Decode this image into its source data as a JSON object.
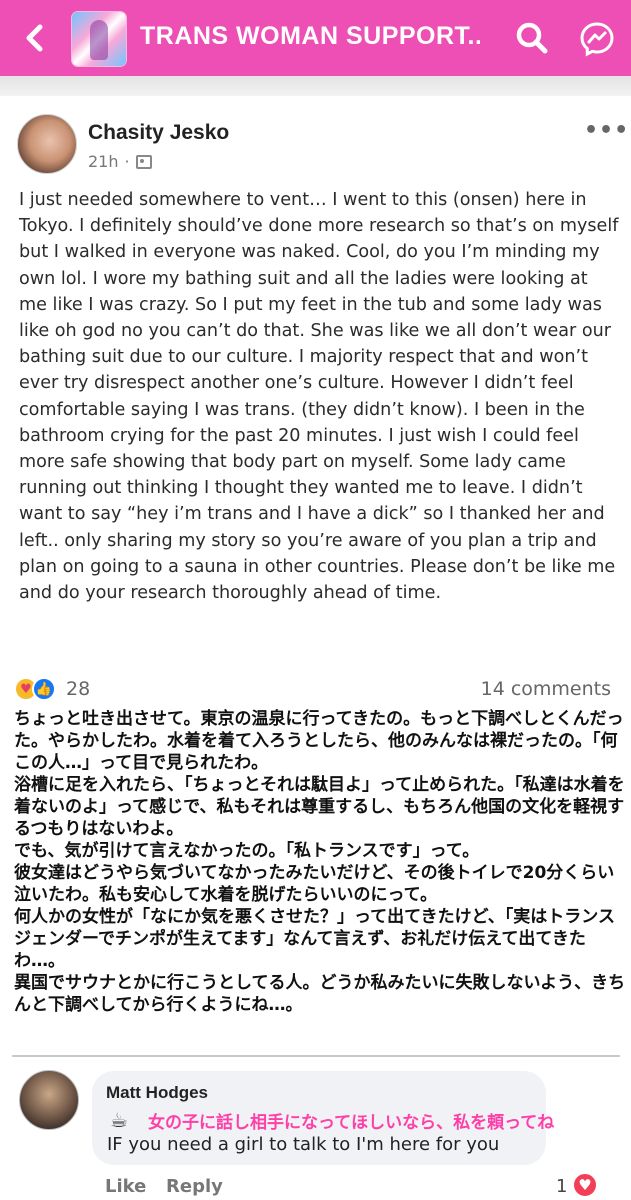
{
  "header": {
    "back_icon": "chevron-left-icon",
    "group_title": "TRANS WOMAN SUPPORT...",
    "search_icon": "search-icon",
    "messenger_icon": "messenger-icon",
    "background_color": "#ee4fb5"
  },
  "post": {
    "author": "Chasity Jesko",
    "time": "21h",
    "separator": "·",
    "audience_icon": "group-icon",
    "more_label": "•••",
    "text": "I just needed somewhere to vent… I went to this (onsen) here in Tokyo. I definitely should’ve done more research so that’s on myself but I walked in everyone was naked. Cool, do you I’m minding my own lol. I wore my bathing suit and all the ladies were looking at me like I was crazy. So I put my feet in the tub and some lady was like oh god no you can’t do that. She was like we all don’t wear our bathing suit due to our culture. I majority respect that and won’t ever try disrespect another one’s culture. However I didn’t feel comfortable saying I was trans. (they didn’t know). I been in the bathroom crying for the past 20 minutes. I just wish I could feel more safe showing that body part on myself. Some lady came running out thinking I thought they wanted me to leave. I didn’t want to say “hey i’m trans and I have a dick” so I thanked her and left.. only sharing my story so you’re aware of you plan a trip and plan on going to a sauna in other countries. Please don’t be like me and do your research thoroughly ahead of time.",
    "reaction_count": "28",
    "comments_count": "14 comments"
  },
  "translation": {
    "text": "ちょっと吐き出させて。東京の温泉に行ってきたの。もっと下調べしとくんだった。やらかしたわ。水着を着て入ろうとしたら、他のみんなは裸だったの。「何この人…」って目で見られたわ。\n浴槽に足を入れたら、「ちょっとそれは駄目よ」って止められた。「私達は水着を着ないのよ」って感じで、私もそれは尊重するし、もちろん他国の文化を軽視するつもりはないわよ。\nでも、気が引けて言えなかったの。「私トランスです」って。\n彼女達はどうやら気づいてなかったみたいだけど、その後トイレで20分くらい泣いたわ。私も安心して水着を脱げたらいいのにって。\n何人かの女性が「なにか気を悪くさせた？」って出てきたけど、「実はトランスジェンダーでチンポが生えてます」なんて言えず、お礼だけ伝えて出てきたわ…。\n異国でサウナとかに行こうとしてる人。どうか私みたいに失敗しないよう、きちんと下調べしてから行くようにね…。"
  },
  "comment": {
    "author": "Matt Hodges",
    "emoji": "☕",
    "jp_text": "女の子に話し相手になってほしいなら、私を頼ってね",
    "text": "IF you need a girl to talk to I'm here for you",
    "like_label": "Like",
    "reply_label": "Reply",
    "reaction_count": "1",
    "reaction_icon": "heart-icon"
  }
}
